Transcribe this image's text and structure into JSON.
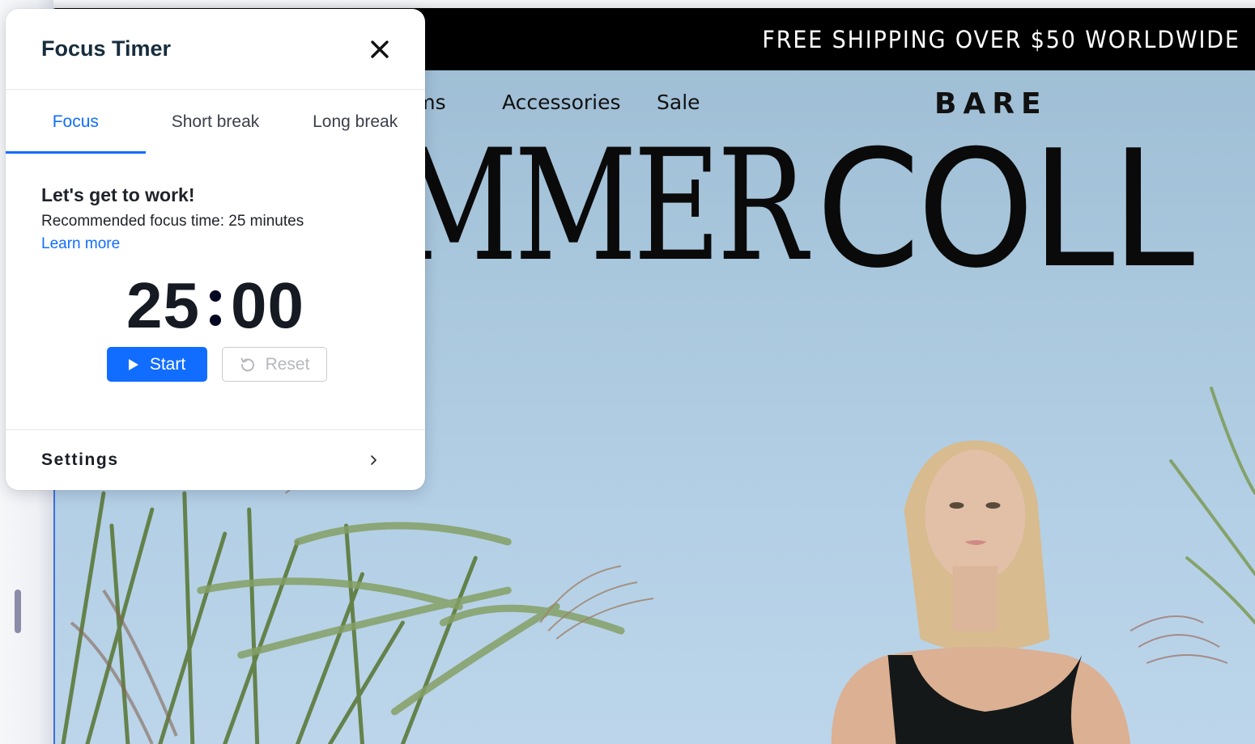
{
  "editor": {
    "scrollbar_icon": "vertical-scroll-handle"
  },
  "website": {
    "promo_bar": {
      "text": "FREE SHIPPING OVER $50 WORLDWIDE",
      "background": "#000000",
      "color": "#ffffff"
    },
    "nav": {
      "items": [
        {
          "label": "Bottoms",
          "visible_text": "oms"
        },
        {
          "label": "Accessories"
        },
        {
          "label": "Sale"
        }
      ],
      "brand": "BARE"
    },
    "hero": {
      "title_serif": "MMER",
      "title_sans": "COLL",
      "image_description": "woman in black swimsuit against blue sky with reeds"
    }
  },
  "timer_panel": {
    "title": "Focus Timer",
    "close_icon": "close-icon",
    "tabs": [
      {
        "label": "Focus",
        "active": true
      },
      {
        "label": "Short break",
        "active": false
      },
      {
        "label": "Long break",
        "active": false
      }
    ],
    "heading": "Let's get to work!",
    "recommendation": "Recommended focus time: 25 minutes",
    "learn_more": "Learn more",
    "timer": {
      "minutes": "25",
      "seconds": "00"
    },
    "buttons": {
      "start": {
        "label": "Start",
        "icon": "play-icon"
      },
      "reset": {
        "label": "Reset",
        "icon": "reset-icon",
        "disabled": true
      }
    },
    "settings": {
      "label": "Settings",
      "icon": "chevron-right-icon"
    },
    "colors": {
      "accent": "#116dff",
      "text": "#162d3d",
      "disabled": "#b6b8bd"
    }
  }
}
